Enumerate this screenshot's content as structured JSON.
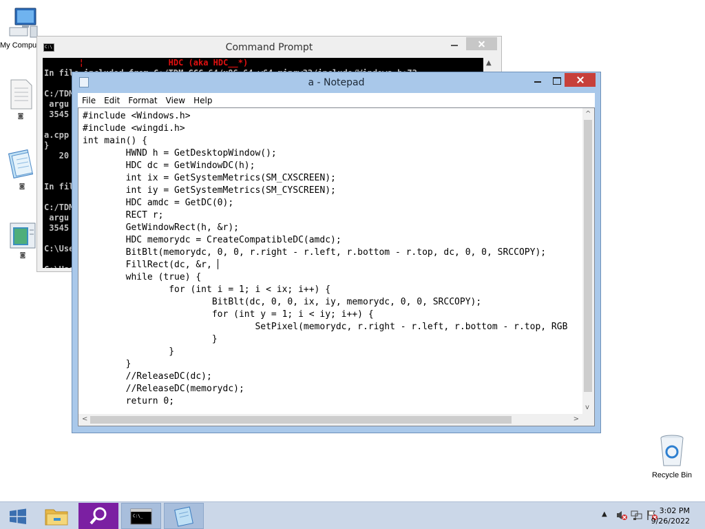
{
  "desktop": {
    "icons": [
      {
        "name": "my-computer",
        "label": "My Computer"
      },
      {
        "name": "document",
        "label": ""
      },
      {
        "name": "notepad",
        "label": ""
      },
      {
        "name": "app",
        "label": ""
      },
      {
        "name": "recycle-bin",
        "label": "Recycle Bin"
      }
    ]
  },
  "cmd_window": {
    "title": "Command Prompt",
    "lines": [
      {
        "text": "       ¦                 HDC (aka HDC__*)",
        "red": true
      },
      {
        "text": "In file included from C:/TDM-GCC-64/x86_64-w64-mingw32/include/Windows.h:72"
      },
      {
        "text": ""
      },
      {
        "text": "C:/TDM"
      },
      {
        "text": " argu"
      },
      {
        "text": " 3545"
      },
      {
        "text": ""
      },
      {
        "text": "a.cpp"
      },
      {
        "text": "}"
      },
      {
        "text": "   20"
      },
      {
        "text": ""
      },
      {
        "text": ""
      },
      {
        "text": "In fil"
      },
      {
        "text": ""
      },
      {
        "text": "C:/TDM"
      },
      {
        "text": " argu"
      },
      {
        "text": " 3545"
      },
      {
        "text": ""
      },
      {
        "text": "C:\\Use"
      },
      {
        "text": ""
      },
      {
        "text": "C:\\Use"
      },
      {
        "text": ""
      },
      {
        "text": "C:\\Use"
      }
    ]
  },
  "notepad_window": {
    "title": "a - Notepad",
    "menu": [
      "File",
      "Edit",
      "Format",
      "View",
      "Help"
    ],
    "code_lines": [
      "#include <Windows.h>",
      "#include <wingdi.h>",
      "int main() {",
      "        HWND h = GetDesktopWindow();",
      "        HDC dc = GetWindowDC(h);",
      "        int ix = GetSystemMetrics(SM_CXSCREEN);",
      "        int iy = GetSystemMetrics(SM_CYSCREEN);",
      "        HDC amdc = GetDC(0);",
      "        RECT r;",
      "        GetWindowRect(h, &r);",
      "        HDC memorydc = CreateCompatibleDC(amdc);",
      "        BitBlt(memorydc, 0, 0, r.right - r.left, r.bottom - r.top, dc, 0, 0, SRCCOPY);",
      "        FillRect(dc, &r, ",
      "        while (true) {",
      "                for (int i = 1; i < ix; i++) {",
      "                        BitBlt(dc, 0, 0, ix, iy, memorydc, 0, 0, SRCCOPY);",
      "                        for (int y = 1; i < iy; i++) {",
      "                                SetPixel(memorydc, r.right - r.left, r.bottom - r.top, RGB",
      "                        }",
      "                }",
      "        }",
      "        //ReleaseDC(dc);",
      "        //ReleaseDC(memorydc);",
      "        return 0;"
    ],
    "caret_line": 12
  },
  "taskbar": {
    "items": [
      {
        "name": "start-button"
      },
      {
        "name": "file-explorer"
      },
      {
        "name": "search-app"
      },
      {
        "name": "command-prompt"
      },
      {
        "name": "notepad"
      }
    ],
    "clock": {
      "time": "3:02 PM",
      "date": "9/26/2022"
    }
  },
  "colors": {
    "notepad_frame": "#a9c8ea",
    "close_red": "#c7403a",
    "taskbar": "#cbd7e8",
    "search_purple": "#7b1fa2"
  }
}
